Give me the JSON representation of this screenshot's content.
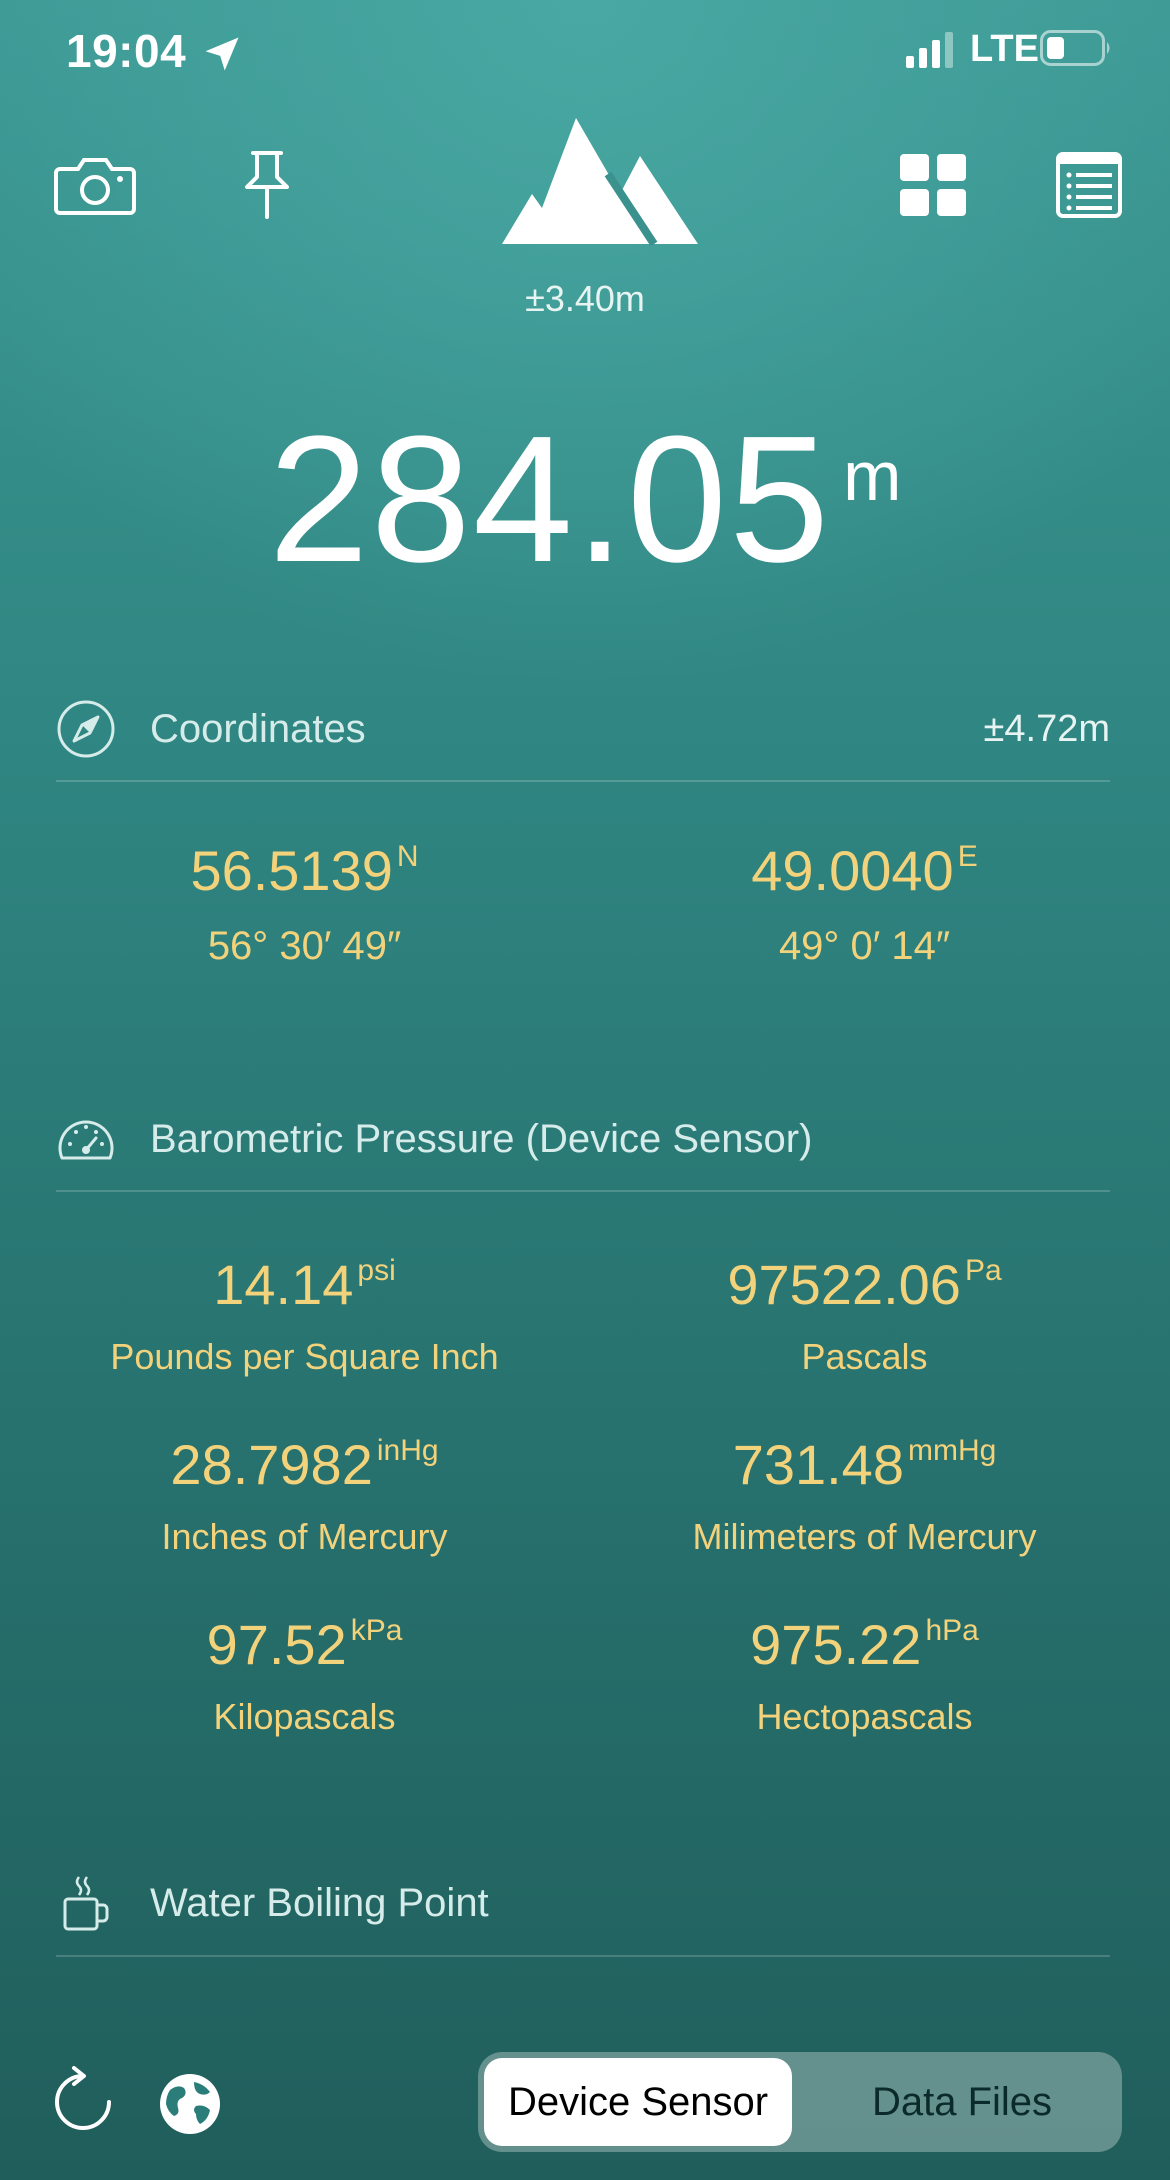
{
  "status_bar": {
    "time": "19:04",
    "network": "LTE"
  },
  "toolbar": {
    "accuracy": "±3.40m",
    "icons": [
      "camera-icon",
      "pin-icon",
      "mountain-logo-icon",
      "grid-icon",
      "list-icon"
    ]
  },
  "altitude": {
    "value": "284.05",
    "unit": "m"
  },
  "coordinates": {
    "title": "Coordinates",
    "accuracy": "±4.72m",
    "lat": {
      "value": "56.5139",
      "dir": "N",
      "dms": "56° 30′ 49″"
    },
    "lon": {
      "value": "49.0040",
      "dir": "E",
      "dms": "49° 0′ 14″"
    }
  },
  "pressure": {
    "title": "Barometric Pressure (Device Sensor)",
    "items": [
      {
        "value": "14.14",
        "unit": "psi",
        "label": "Pounds per Square Inch"
      },
      {
        "value": "97522.06",
        "unit": "Pa",
        "label": "Pascals"
      },
      {
        "value": "28.7982",
        "unit": "inHg",
        "label": "Inches of Mercury"
      },
      {
        "value": "731.48",
        "unit": "mmHg",
        "label": "Milimeters of Mercury"
      },
      {
        "value": "97.52",
        "unit": "kPa",
        "label": "Kilopascals"
      },
      {
        "value": "975.22",
        "unit": "hPa",
        "label": "Hectopascals"
      }
    ]
  },
  "boiling": {
    "title": "Water Boiling Point"
  },
  "bottom": {
    "segment_active": "Device Sensor",
    "segment_other": "Data Files"
  },
  "colors": {
    "accent_gold": "#f3d27c",
    "background_top": "#3c9893",
    "background_bottom": "#205e5b"
  }
}
